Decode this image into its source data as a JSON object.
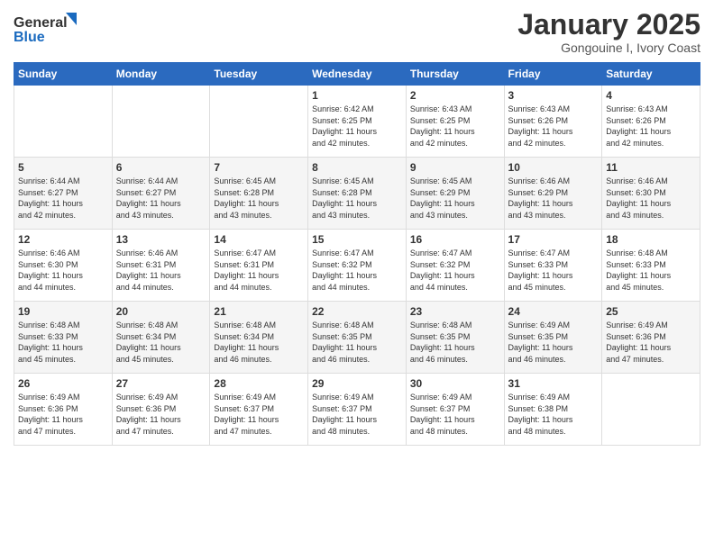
{
  "logo": {
    "line1": "General",
    "line2": "Blue"
  },
  "title": "January 2025",
  "subtitle": "Gongouine I, Ivory Coast",
  "days_of_week": [
    "Sunday",
    "Monday",
    "Tuesday",
    "Wednesday",
    "Thursday",
    "Friday",
    "Saturday"
  ],
  "weeks": [
    [
      {
        "day": "",
        "info": ""
      },
      {
        "day": "",
        "info": ""
      },
      {
        "day": "",
        "info": ""
      },
      {
        "day": "1",
        "info": "Sunrise: 6:42 AM\nSunset: 6:25 PM\nDaylight: 11 hours\nand 42 minutes."
      },
      {
        "day": "2",
        "info": "Sunrise: 6:43 AM\nSunset: 6:25 PM\nDaylight: 11 hours\nand 42 minutes."
      },
      {
        "day": "3",
        "info": "Sunrise: 6:43 AM\nSunset: 6:26 PM\nDaylight: 11 hours\nand 42 minutes."
      },
      {
        "day": "4",
        "info": "Sunrise: 6:43 AM\nSunset: 6:26 PM\nDaylight: 11 hours\nand 42 minutes."
      }
    ],
    [
      {
        "day": "5",
        "info": "Sunrise: 6:44 AM\nSunset: 6:27 PM\nDaylight: 11 hours\nand 42 minutes."
      },
      {
        "day": "6",
        "info": "Sunrise: 6:44 AM\nSunset: 6:27 PM\nDaylight: 11 hours\nand 43 minutes."
      },
      {
        "day": "7",
        "info": "Sunrise: 6:45 AM\nSunset: 6:28 PM\nDaylight: 11 hours\nand 43 minutes."
      },
      {
        "day": "8",
        "info": "Sunrise: 6:45 AM\nSunset: 6:28 PM\nDaylight: 11 hours\nand 43 minutes."
      },
      {
        "day": "9",
        "info": "Sunrise: 6:45 AM\nSunset: 6:29 PM\nDaylight: 11 hours\nand 43 minutes."
      },
      {
        "day": "10",
        "info": "Sunrise: 6:46 AM\nSunset: 6:29 PM\nDaylight: 11 hours\nand 43 minutes."
      },
      {
        "day": "11",
        "info": "Sunrise: 6:46 AM\nSunset: 6:30 PM\nDaylight: 11 hours\nand 43 minutes."
      }
    ],
    [
      {
        "day": "12",
        "info": "Sunrise: 6:46 AM\nSunset: 6:30 PM\nDaylight: 11 hours\nand 44 minutes."
      },
      {
        "day": "13",
        "info": "Sunrise: 6:46 AM\nSunset: 6:31 PM\nDaylight: 11 hours\nand 44 minutes."
      },
      {
        "day": "14",
        "info": "Sunrise: 6:47 AM\nSunset: 6:31 PM\nDaylight: 11 hours\nand 44 minutes."
      },
      {
        "day": "15",
        "info": "Sunrise: 6:47 AM\nSunset: 6:32 PM\nDaylight: 11 hours\nand 44 minutes."
      },
      {
        "day": "16",
        "info": "Sunrise: 6:47 AM\nSunset: 6:32 PM\nDaylight: 11 hours\nand 44 minutes."
      },
      {
        "day": "17",
        "info": "Sunrise: 6:47 AM\nSunset: 6:33 PM\nDaylight: 11 hours\nand 45 minutes."
      },
      {
        "day": "18",
        "info": "Sunrise: 6:48 AM\nSunset: 6:33 PM\nDaylight: 11 hours\nand 45 minutes."
      }
    ],
    [
      {
        "day": "19",
        "info": "Sunrise: 6:48 AM\nSunset: 6:33 PM\nDaylight: 11 hours\nand 45 minutes."
      },
      {
        "day": "20",
        "info": "Sunrise: 6:48 AM\nSunset: 6:34 PM\nDaylight: 11 hours\nand 45 minutes."
      },
      {
        "day": "21",
        "info": "Sunrise: 6:48 AM\nSunset: 6:34 PM\nDaylight: 11 hours\nand 46 minutes."
      },
      {
        "day": "22",
        "info": "Sunrise: 6:48 AM\nSunset: 6:35 PM\nDaylight: 11 hours\nand 46 minutes."
      },
      {
        "day": "23",
        "info": "Sunrise: 6:48 AM\nSunset: 6:35 PM\nDaylight: 11 hours\nand 46 minutes."
      },
      {
        "day": "24",
        "info": "Sunrise: 6:49 AM\nSunset: 6:35 PM\nDaylight: 11 hours\nand 46 minutes."
      },
      {
        "day": "25",
        "info": "Sunrise: 6:49 AM\nSunset: 6:36 PM\nDaylight: 11 hours\nand 47 minutes."
      }
    ],
    [
      {
        "day": "26",
        "info": "Sunrise: 6:49 AM\nSunset: 6:36 PM\nDaylight: 11 hours\nand 47 minutes."
      },
      {
        "day": "27",
        "info": "Sunrise: 6:49 AM\nSunset: 6:36 PM\nDaylight: 11 hours\nand 47 minutes."
      },
      {
        "day": "28",
        "info": "Sunrise: 6:49 AM\nSunset: 6:37 PM\nDaylight: 11 hours\nand 47 minutes."
      },
      {
        "day": "29",
        "info": "Sunrise: 6:49 AM\nSunset: 6:37 PM\nDaylight: 11 hours\nand 48 minutes."
      },
      {
        "day": "30",
        "info": "Sunrise: 6:49 AM\nSunset: 6:37 PM\nDaylight: 11 hours\nand 48 minutes."
      },
      {
        "day": "31",
        "info": "Sunrise: 6:49 AM\nSunset: 6:38 PM\nDaylight: 11 hours\nand 48 minutes."
      },
      {
        "day": "",
        "info": ""
      }
    ]
  ]
}
